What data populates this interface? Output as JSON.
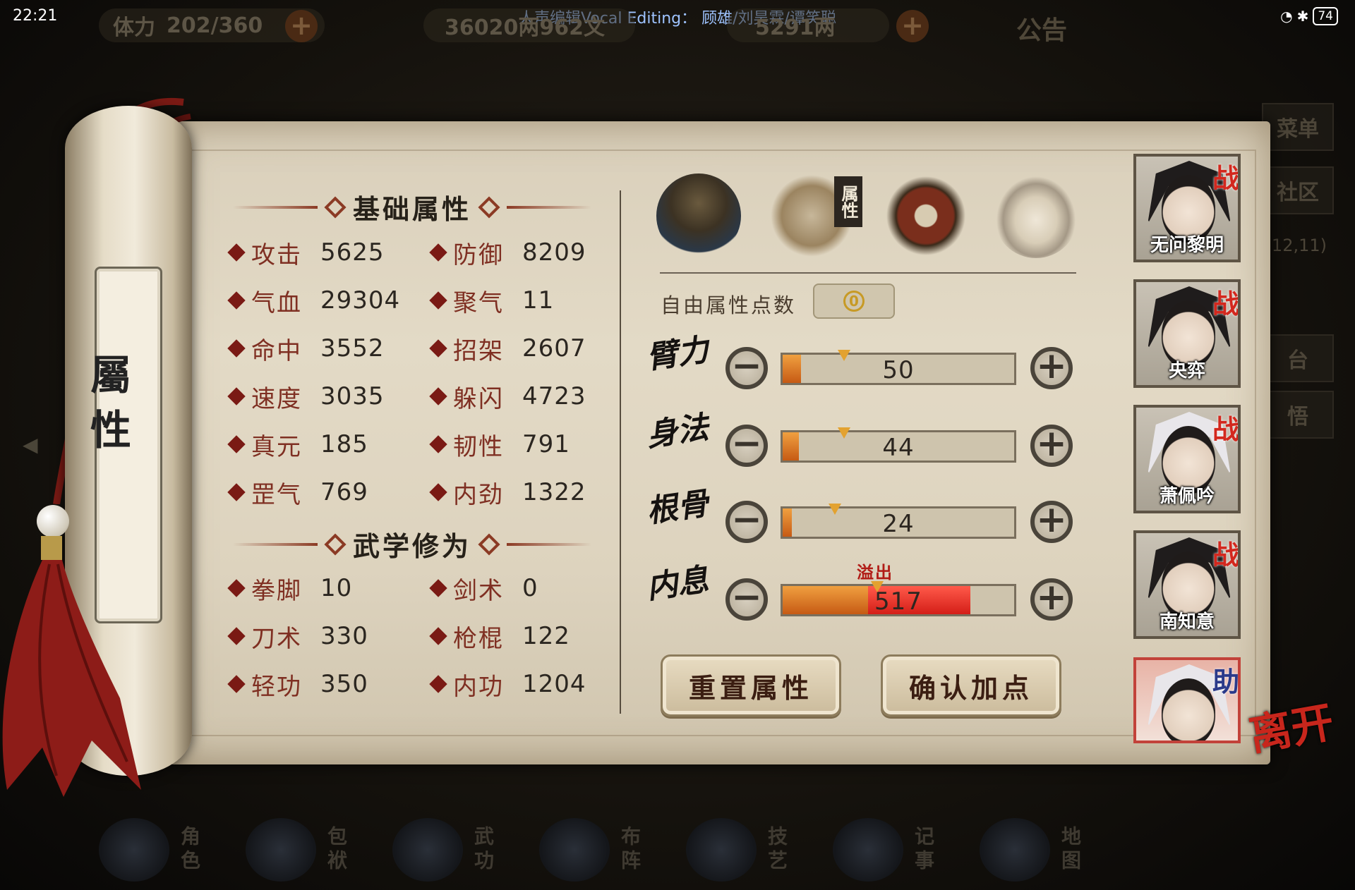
{
  "status_bar": {
    "time": "22:21",
    "caption": "人声编辑Vocal Editing：  顾雄/刘昊霖/谭笑聪",
    "battery": "74"
  },
  "top_bar": {
    "stamina_label": "体力",
    "stamina_value": "202/360",
    "silver_value": "36020两962文",
    "gold_value": "5291两",
    "notice_label": "公告"
  },
  "right_menu": {
    "items": [
      "菜单",
      "社区",
      "台",
      "悟"
    ],
    "coords": "12,11)"
  },
  "scroll": {
    "vertical_title": "屬性"
  },
  "basic_attributes": {
    "heading": "基础属性",
    "items": [
      {
        "label": "攻击",
        "value": "5625"
      },
      {
        "label": "防御",
        "value": "8209"
      },
      {
        "label": "气血",
        "value": "29304"
      },
      {
        "label": "聚气",
        "value": "11"
      },
      {
        "label": "命中",
        "value": "3552"
      },
      {
        "label": "招架",
        "value": "2607"
      },
      {
        "label": "速度",
        "value": "3035"
      },
      {
        "label": "躲闪",
        "value": "4723"
      },
      {
        "label": "真元",
        "value": "185"
      },
      {
        "label": "韧性",
        "value": "791"
      },
      {
        "label": "罡气",
        "value": "769"
      },
      {
        "label": "内劲",
        "value": "1322"
      }
    ]
  },
  "martial_cultivation": {
    "heading": "武学修为",
    "items": [
      {
        "label": "拳脚",
        "value": "10"
      },
      {
        "label": "剑术",
        "value": "0"
      },
      {
        "label": "刀术",
        "value": "330"
      },
      {
        "label": "枪棍",
        "value": "122"
      },
      {
        "label": "轻功",
        "value": "350"
      },
      {
        "label": "内功",
        "value": "1204"
      }
    ]
  },
  "tabs": {
    "attributes_tab_label": "属性"
  },
  "allocation": {
    "free_points_label": "自由属性点数",
    "free_points_value": "0",
    "overflow_label": "溢出",
    "rows": [
      {
        "name": "臂力",
        "value": "50",
        "fill": 0.08,
        "marker": 0.27,
        "over": 0
      },
      {
        "name": "身法",
        "value": "44",
        "fill": 0.07,
        "marker": 0.27,
        "over": 0
      },
      {
        "name": "根骨",
        "value": "24",
        "fill": 0.04,
        "marker": 0.23,
        "over": 0
      },
      {
        "name": "内息",
        "value": "517",
        "fill": 0.37,
        "marker": 0.41,
        "over": 0.44
      }
    ],
    "minus_symbol": "−",
    "plus_symbol": "+",
    "reset_button": "重置属性",
    "confirm_button": "确认加点"
  },
  "party": {
    "members": [
      {
        "name": "无问黎明",
        "badge": "战",
        "hair": "dark"
      },
      {
        "name": "央弈",
        "badge": "战",
        "hair": "dark"
      },
      {
        "name": "萧佩吟",
        "badge": "战",
        "hair": "white"
      },
      {
        "name": "南知意",
        "badge": "战",
        "hair": "dark"
      },
      {
        "name": "",
        "badge": "助",
        "hair": "white"
      }
    ],
    "leave_label": "离开"
  },
  "bottom_nav": {
    "items": [
      "角色",
      "包袱",
      "武功",
      "布阵",
      "技艺",
      "记事",
      "地图"
    ]
  },
  "colors": {
    "parchment": "#ddd3be",
    "accent_red": "#7f2f22",
    "bar_orange": "#c65a14",
    "bar_overflow": "#d41e18",
    "badge_red": "#d3281e"
  }
}
